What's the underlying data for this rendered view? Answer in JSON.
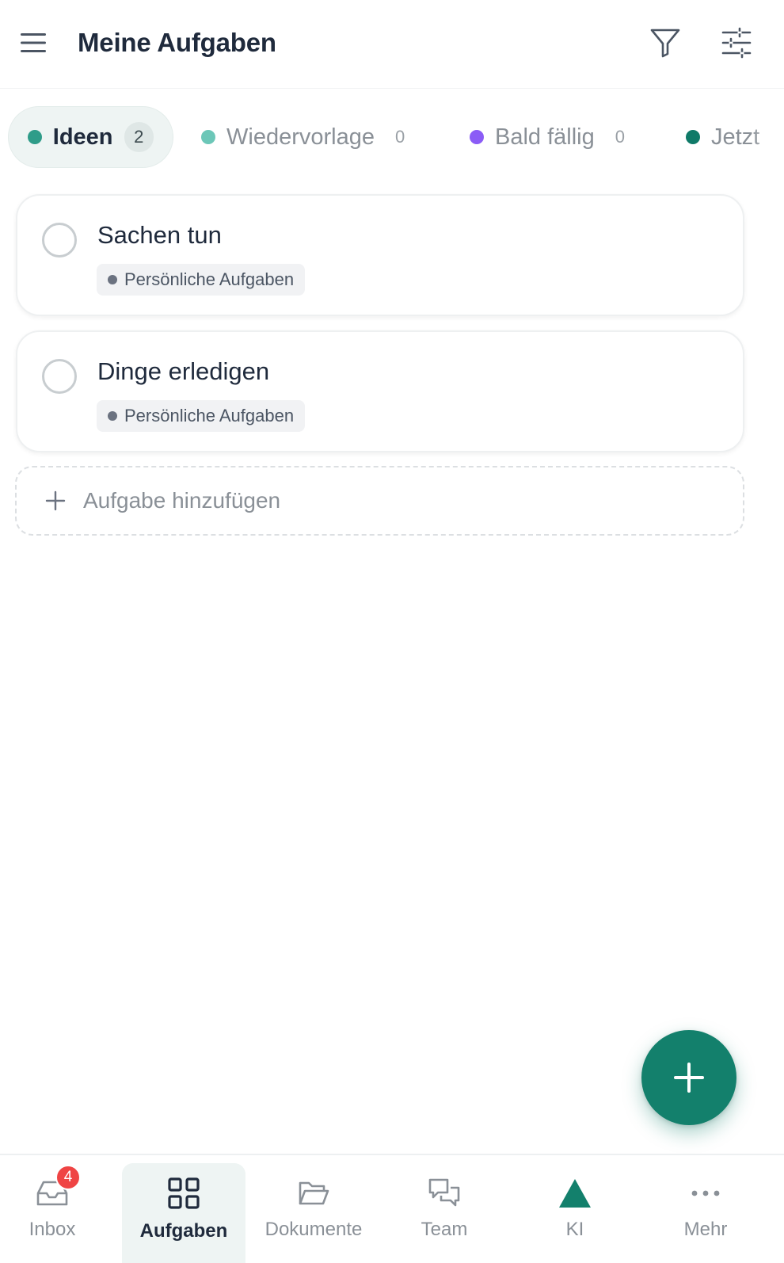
{
  "header": {
    "title": "Meine Aufgaben",
    "icons": {
      "menu": "hamburger-icon",
      "filter": "filter-icon",
      "settings": "sliders-icon"
    }
  },
  "tabs": [
    {
      "label": "Ideen",
      "count": "2",
      "color": "#2f9c89",
      "active": true
    },
    {
      "label": "Wiedervorlage",
      "count": "0",
      "color": "#6cc7b8",
      "active": false
    },
    {
      "label": "Bald fällig",
      "count": "0",
      "color": "#8b5cf6",
      "active": false
    },
    {
      "label": "Jetzt",
      "count": "",
      "color": "#0f7a68",
      "active": false
    }
  ],
  "tasks": [
    {
      "title": "Sachen tun",
      "tag": "Persönliche Aufgaben"
    },
    {
      "title": "Dinge erledigen",
      "tag": "Persönliche Aufgaben"
    }
  ],
  "add_task": {
    "label": "Aufgabe hinzufügen"
  },
  "fab": {
    "icon": "plus-icon",
    "color": "#13806c"
  },
  "bottom_nav": [
    {
      "label": "Inbox",
      "icon": "inbox-icon",
      "badge": "4",
      "active": false
    },
    {
      "label": "Aufgaben",
      "icon": "grid-icon",
      "active": true
    },
    {
      "label": "Dokumente",
      "icon": "folder-icon",
      "active": false
    },
    {
      "label": "Team",
      "icon": "chat-bubbles-icon",
      "active": false
    },
    {
      "label": "KI",
      "icon": "triangle-icon",
      "active": false
    },
    {
      "label": "Mehr",
      "icon": "more-dots-icon",
      "active": false
    }
  ]
}
